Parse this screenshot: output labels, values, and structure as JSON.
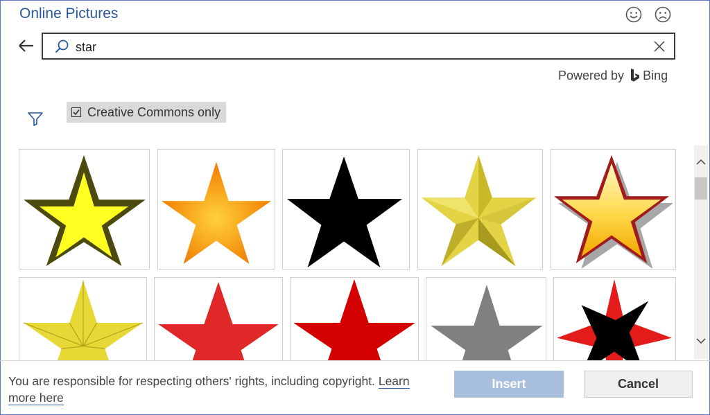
{
  "dialog": {
    "title": "Online Pictures"
  },
  "search": {
    "value": "star"
  },
  "powered": {
    "prefix": "Powered by",
    "brand": "Bing"
  },
  "filter": {
    "creative_commons_label": "Creative Commons only",
    "checked": true
  },
  "notice": {
    "text": "You are responsible for respecting others' rights, including copyright.",
    "link": "Learn more here"
  },
  "buttons": {
    "insert": "Insert",
    "cancel": "Cancel"
  },
  "colors": {
    "accent": "#2b579a",
    "insert_disabled": "#a7bedd"
  },
  "results": [
    {
      "name": "yellow-star-dark-outline"
    },
    {
      "name": "orange-gradient-star"
    },
    {
      "name": "black-star"
    },
    {
      "name": "gold-3d-star"
    },
    {
      "name": "glossy-yellow-star-red-outline"
    },
    {
      "name": "gold-faceted-star"
    },
    {
      "name": "red-star"
    },
    {
      "name": "bright-red-star"
    },
    {
      "name": "gray-star"
    },
    {
      "name": "red-black-six-point-star"
    }
  ]
}
